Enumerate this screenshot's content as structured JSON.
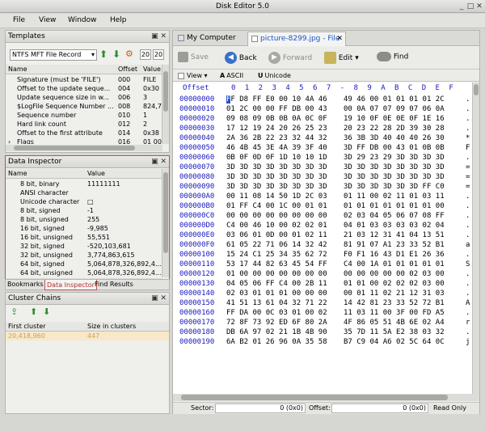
{
  "app": {
    "title": "Disk Editor 5.0"
  },
  "menu": [
    "File",
    "View",
    "Window",
    "Help"
  ],
  "templates": {
    "title": "Templates",
    "selected": "NTFS MFT File Record",
    "page_num": "20",
    "cols": [
      "Name",
      "Offset",
      "Value"
    ],
    "rows": [
      {
        "name": "Signature (must be 'FILE')",
        "offset": "000",
        "value": "FILE"
      },
      {
        "name": "Offset to the update seque...",
        "offset": "004",
        "value": "0x30"
      },
      {
        "name": "Update sequence size in w...",
        "offset": "006",
        "value": "3"
      },
      {
        "name": "$LogFile Sequence Number ...",
        "offset": "008",
        "value": "824,7"
      },
      {
        "name": "Sequence number",
        "offset": "010",
        "value": "1"
      },
      {
        "name": "Hard link count",
        "offset": "012",
        "value": "2"
      },
      {
        "name": "Offset to the first attribute",
        "offset": "014",
        "value": "0x38"
      },
      {
        "name": "Flags",
        "offset": "016",
        "value": "01 00"
      }
    ]
  },
  "inspector": {
    "title": "Data Inspector",
    "cols": [
      "Name",
      "Value"
    ],
    "rows": [
      {
        "name": "8 bit, binary",
        "value": "11111111"
      },
      {
        "name": "ANSI character",
        "value": ""
      },
      {
        "name": "Unicode character",
        "value": "□"
      },
      {
        "name": "8 bit, signed",
        "value": "-1"
      },
      {
        "name": "8 bit, unsigned",
        "value": "255"
      },
      {
        "name": "16 bit, signed",
        "value": "-9,985"
      },
      {
        "name": "16 bit, unsigned",
        "value": "55,551"
      },
      {
        "name": "32 bit, signed",
        "value": "-520,103,681"
      },
      {
        "name": "32 bit, unsigned",
        "value": "3,774,863,615"
      },
      {
        "name": "64 bit, signed",
        "value": "5,064,878,326,892,4..."
      },
      {
        "name": "64 bit, unsigned",
        "value": "5,064,878,326,892,4..."
      }
    ]
  },
  "bottom_tabs": [
    "Bookmarks",
    "Data Inspector",
    "Find Results"
  ],
  "clusters": {
    "title": "Cluster Chains",
    "cols": [
      "First cluster",
      "Size in clusters"
    ],
    "rows": [
      {
        "first": "20,418,960",
        "size": "447"
      }
    ]
  },
  "tabs": [
    "My Computer",
    "picture-8299.jpg - File"
  ],
  "toolbar": {
    "save": "Save",
    "back": "Back",
    "forward": "Forward",
    "edit": "Edit",
    "find": "Find"
  },
  "view": {
    "view": "View",
    "ascii": "ASCII",
    "unicode": "Unicode"
  },
  "hex": {
    "offset_label": "Offset",
    "col_header": "0 1 2 3 4 5 6 7 - 8 9 A B C D E F",
    "rows": [
      {
        "off": "00000000",
        "b1": "FF D8 FF E0 00 10 4A 46",
        "b2": "49 46 00 01 01 01 01 2C",
        "asc": "."
      },
      {
        "off": "00000010",
        "b1": "01 2C 00 00 FF DB 00 43",
        "b2": "00 0A 07 07 09 07 06 0A",
        "asc": "."
      },
      {
        "off": "00000020",
        "b1": "09 08 09 0B 0B 0A 0C 0F",
        "b2": "19 10 0F 0E 0E 0F 1E 16",
        "asc": "."
      },
      {
        "off": "00000030",
        "b1": "17 12 19 24 20 26 25 23",
        "b2": "20 23 22 28 2D 39 30 28",
        "asc": "."
      },
      {
        "off": "00000040",
        "b1": "2A 36 2B 22 23 32 44 32",
        "b2": "36 3B 3D 40 40 40 26 30",
        "asc": "*"
      },
      {
        "off": "00000050",
        "b1": "46 4B 45 3E 4A 39 3F 40",
        "b2": "3D FF DB 00 43 01 0B 0B",
        "asc": "F"
      },
      {
        "off": "00000060",
        "b1": "0B 0F 0D 0F 1D 10 10 1D",
        "b2": "3D 29 23 29 3D 3D 3D 3D",
        "asc": "."
      },
      {
        "off": "00000070",
        "b1": "3D 3D 3D 3D 3D 3D 3D 3D",
        "b2": "3D 3D 3D 3D 3D 3D 3D 3D",
        "asc": "="
      },
      {
        "off": "00000080",
        "b1": "3D 3D 3D 3D 3D 3D 3D 3D",
        "b2": "3D 3D 3D 3D 3D 3D 3D 3D",
        "asc": "="
      },
      {
        "off": "00000090",
        "b1": "3D 3D 3D 3D 3D 3D 3D 3D",
        "b2": "3D 3D 3D 3D 3D 3D FF C0",
        "asc": "="
      },
      {
        "off": "000000A0",
        "b1": "00 11 08 14 50 1D 2C 03",
        "b2": "01 11 00 02 11 01 03 11",
        "asc": "."
      },
      {
        "off": "000000B0",
        "b1": "01 FF C4 00 1C 00 01 01",
        "b2": "01 01 01 01 01 01 01 00",
        "asc": "."
      },
      {
        "off": "000000C0",
        "b1": "00 00 00 00 00 00 00 00",
        "b2": "02 03 04 05 06 07 08 FF",
        "asc": "."
      },
      {
        "off": "000000D0",
        "b1": "C4 00 46 10 00 02 02 01",
        "b2": "04 01 03 03 03 03 02 04",
        "asc": "."
      },
      {
        "off": "000000E0",
        "b1": "03 06 01 0D 00 01 02 11",
        "b2": "21 03 12 31 41 04 13 51",
        "asc": "."
      },
      {
        "off": "000000F0",
        "b1": "61 05 22 71 06 14 32 42",
        "b2": "81 91 07 A1 23 33 52 B1",
        "asc": "a"
      },
      {
        "off": "00000100",
        "b1": "15 24 C1 25 34 35 62 72",
        "b2": "F0 F1 16 43 D1 E1 26 36",
        "asc": "."
      },
      {
        "off": "00000110",
        "b1": "53 17 44 82 63 45 54 FF",
        "b2": "C4 00 1A 01 01 01 01 01",
        "asc": "S"
      },
      {
        "off": "00000120",
        "b1": "01 00 00 00 00 00 00 00",
        "b2": "00 00 00 00 00 02 03 00",
        "asc": "."
      },
      {
        "off": "00000130",
        "b1": "04 05 06 FF C4 00 2B 11",
        "b2": "01 01 00 02 02 02 03 00",
        "asc": "."
      },
      {
        "off": "00000140",
        "b1": "02 03 01 01 01 00 00 00",
        "b2": "00 01 11 02 21 12 31 03",
        "asc": "."
      },
      {
        "off": "00000150",
        "b1": "41 51 13 61 04 32 71 22",
        "b2": "14 42 81 23 33 52 72 B1",
        "asc": "A"
      },
      {
        "off": "00000160",
        "b1": "FF DA 00 0C 03 01 00 02",
        "b2": "11 03 11 00 3F 00 FD A5",
        "asc": "."
      },
      {
        "off": "00000170",
        "b1": "72 8F 73 92 ED 6F 80 2A",
        "b2": "4F 86 05 51 4B 6E 02 A4",
        "asc": "r"
      },
      {
        "off": "00000180",
        "b1": "DB 6A 97 02 21 1B 4B 90",
        "b2": "35 7D 11 5A E2 38 03 32",
        "asc": "."
      },
      {
        "off": "00000190",
        "b1": "6A B2 01 26 96 0A 35 58",
        "b2": "B7 C9 04 A6 02 5C 64 0C",
        "asc": "j"
      }
    ]
  },
  "status": {
    "sector_label": "Sector:",
    "sector_val": "0 (0x0)",
    "offset_label": "Offset:",
    "offset_val": "0 (0x0)",
    "mode": "Read Only"
  }
}
